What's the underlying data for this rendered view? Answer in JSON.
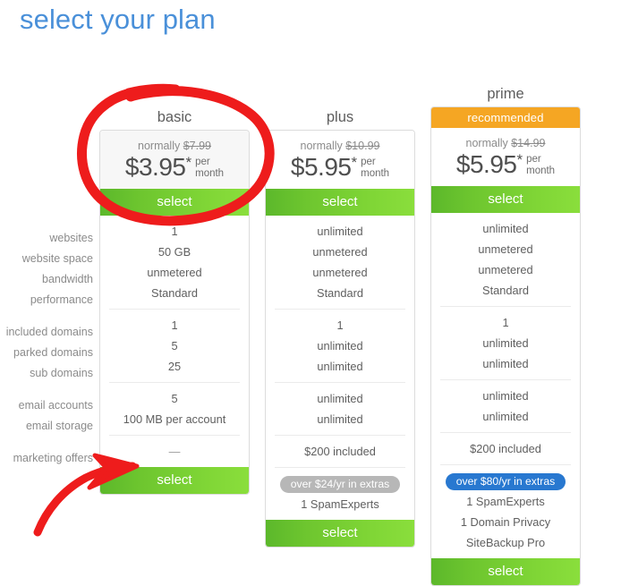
{
  "page": {
    "title": "select your plan",
    "title_color": "#4a90d9",
    "background": "#ffffff"
  },
  "feature_labels": {
    "group1": [
      "websites",
      "website space",
      "bandwidth",
      "performance"
    ],
    "group2": [
      "included domains",
      "parked domains",
      "sub domains"
    ],
    "group3": [
      "email accounts",
      "email storage"
    ],
    "group4": [
      "marketing offers"
    ]
  },
  "colors": {
    "green_button": "#6ec62f",
    "orange_ribbon": "#f5a623",
    "gray_pill": "#b7b7b7",
    "blue_pill": "#2878d0",
    "annotation_red": "#ee1c1c",
    "card_border": "#dcdcdc",
    "text_muted": "#8b8b8b",
    "text_value": "#5f5f5f"
  },
  "plans": {
    "basic": {
      "name": "basic",
      "ribbon": null,
      "normally_prefix": "normally ",
      "normally_price": "$7.99",
      "price": "$3.95",
      "price_star": "*",
      "per": "per",
      "month": "month",
      "select_top_label": "select",
      "select_bottom_label": "select",
      "group1": [
        "1",
        "50 GB",
        "unmetered",
        "Standard"
      ],
      "group2": [
        "1",
        "5",
        "25"
      ],
      "group3": [
        "5",
        "100 MB per account"
      ],
      "group4": [
        "—"
      ],
      "extras_pill": null,
      "extras": []
    },
    "plus": {
      "name": "plus",
      "ribbon": null,
      "normally_prefix": "normally ",
      "normally_price": "$10.99",
      "price": "$5.95",
      "price_star": "*",
      "per": "per",
      "month": "month",
      "select_top_label": "select",
      "select_bottom_label": "select",
      "group1": [
        "unlimited",
        "unmetered",
        "unmetered",
        "Standard"
      ],
      "group2": [
        "1",
        "unlimited",
        "unlimited"
      ],
      "group3": [
        "unlimited",
        "unlimited"
      ],
      "group4": [
        "$200 included"
      ],
      "extras_pill": "over $24/yr in extras",
      "extras": [
        "1 SpamExperts"
      ]
    },
    "prime": {
      "name": "prime",
      "ribbon": "recommended",
      "normally_prefix": "normally ",
      "normally_price": "$14.99",
      "price": "$5.95",
      "price_star": "*",
      "per": "per",
      "month": "month",
      "select_top_label": "select",
      "select_bottom_label": "select",
      "group1": [
        "unlimited",
        "unmetered",
        "unmetered",
        "Standard"
      ],
      "group2": [
        "1",
        "unlimited",
        "unlimited"
      ],
      "group3": [
        "unlimited",
        "unlimited"
      ],
      "group4": [
        "$200 included"
      ],
      "extras_pill": "over $80/yr in extras",
      "extras": [
        "1 SpamExperts",
        "1 Domain Privacy",
        "SiteBackup Pro"
      ]
    }
  },
  "annotations": {
    "circle_target": "basic plan price and select button",
    "arrow_target": "basic plan bottom select button"
  }
}
